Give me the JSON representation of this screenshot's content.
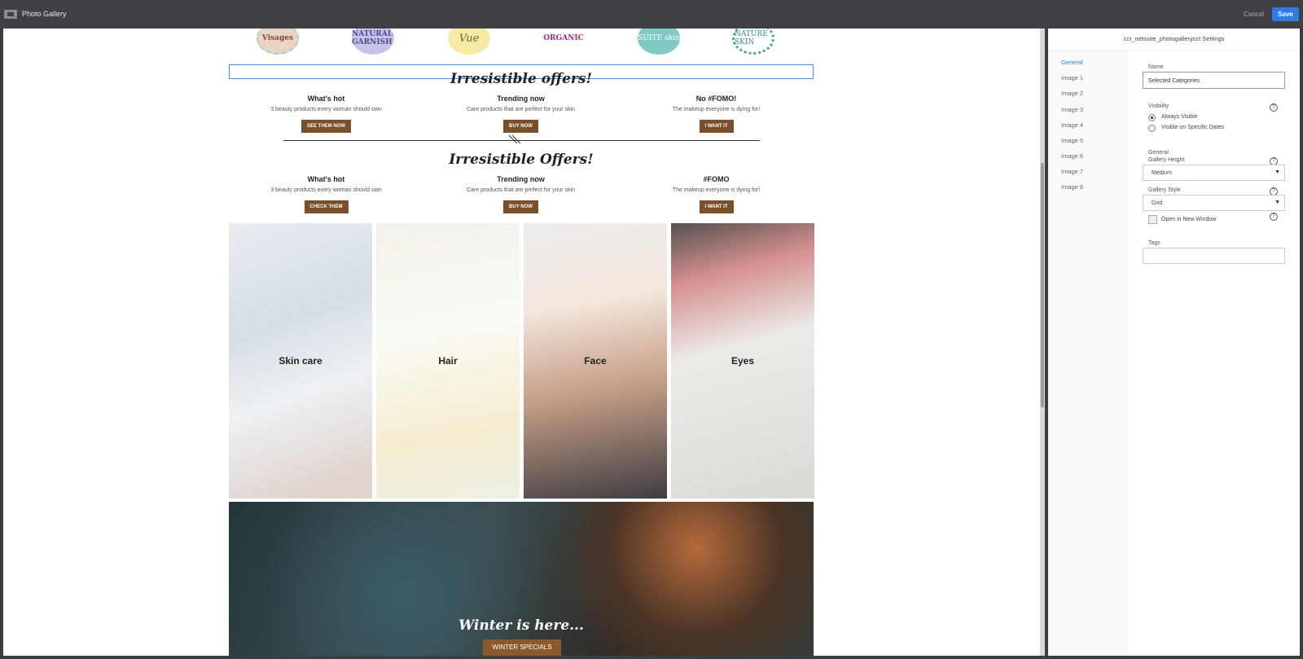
{
  "topbar": {
    "title": "Photo Gallery",
    "cancel": "Cancel",
    "save": "Save"
  },
  "badges": [
    "Visages",
    "NATURAL GARNISH",
    "Vue",
    "ORGANIC",
    "SUITE skin",
    "NATURE SKIN"
  ],
  "offers1": {
    "title": "Irresistible offers!",
    "cols": [
      {
        "heading": "What's hot",
        "text": "3 beauty products every woman should own",
        "button": "SEE THEM NOW"
      },
      {
        "heading": "Trending now",
        "text": "Care products that are perfect for your skin",
        "button": "BUY NOW"
      },
      {
        "heading": "No #FOMO!",
        "text": "The makeup everyone is dying for!",
        "button": "I WANT IT"
      }
    ]
  },
  "offers2": {
    "title": "Irresistible Offers!",
    "cols": [
      {
        "heading": "What's hot",
        "text": "3 beauty products every woman should own",
        "button": "CHECK THEM"
      },
      {
        "heading": "Trending now",
        "text": "Care products that are perfect for your skin",
        "button": "BUY NOW"
      },
      {
        "heading": "#FOMO",
        "text": "The makeup everyone is dying for!",
        "button": "I WANT IT"
      }
    ]
  },
  "tiles": [
    "Skin care",
    "Hair",
    "Face",
    "Eyes"
  ],
  "banner": {
    "title": "Winter is here...",
    "button": "WINTER SPECIALS"
  },
  "settings": {
    "title": "cct_netsuite_photogallerycct Settings",
    "nav": [
      "General",
      "Image 1",
      "Image 2",
      "Image 3",
      "Image 4",
      "Image 5",
      "Image 6",
      "Image 7",
      "Image 8"
    ],
    "name_label": "Name",
    "name_value": "Selected Categories",
    "visibility_label": "Visibility",
    "visibility_options": [
      "Always Visible",
      "Visible on Specific Dates"
    ],
    "general_label": "General",
    "height_label": "Gallery Height",
    "height_value": "Medium",
    "style_label": "Gallery Style",
    "style_value": "Grid",
    "new_window_label": "Open in New Window",
    "tags_label": "Tags",
    "help": "?"
  }
}
